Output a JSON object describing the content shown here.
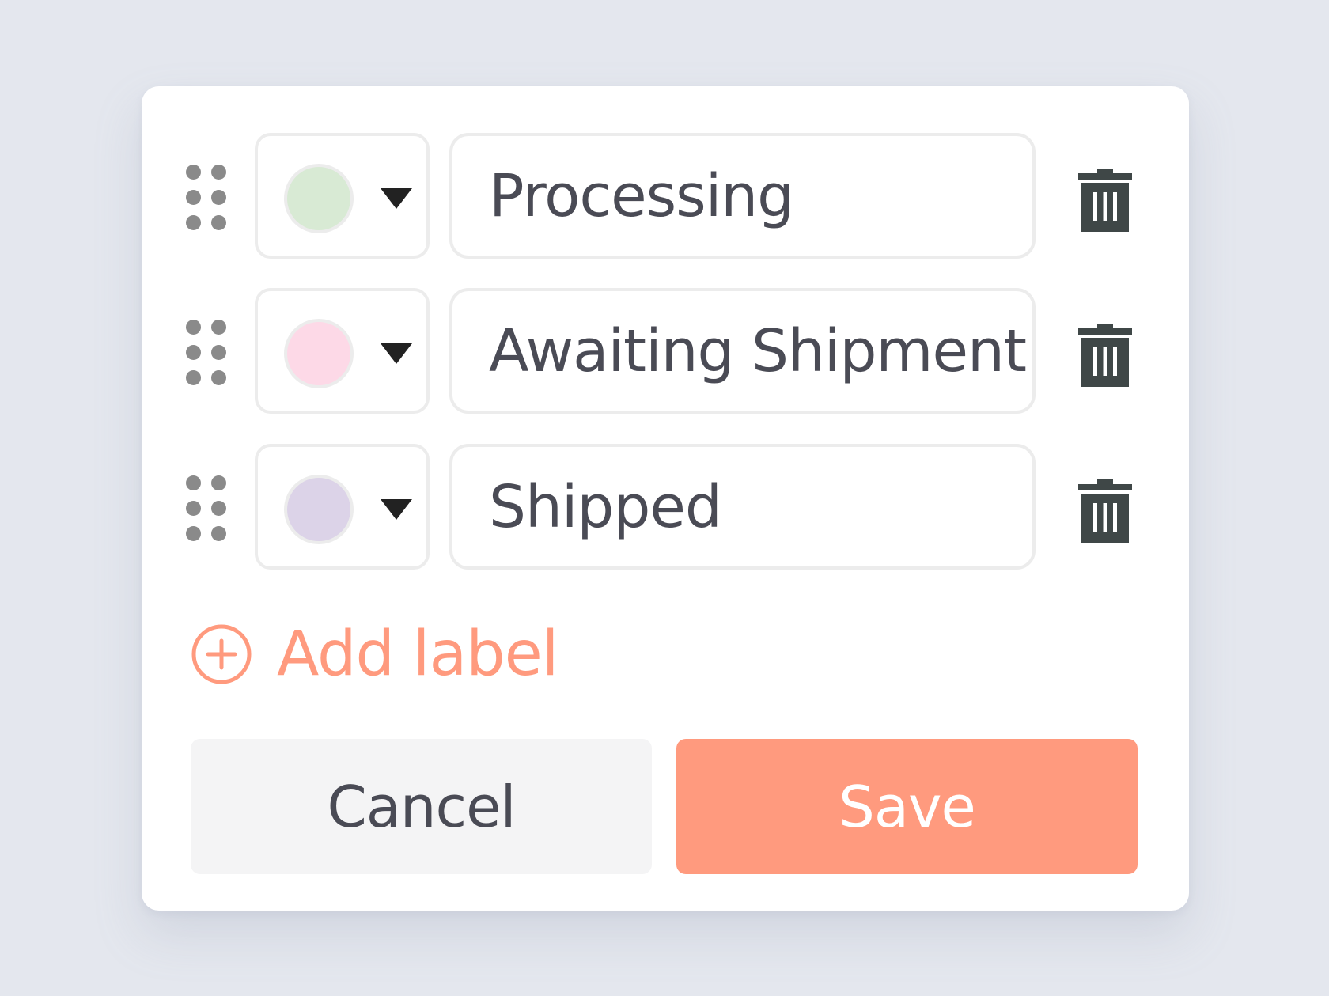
{
  "labels": [
    {
      "name": "Processing",
      "color": "#d8ead4"
    },
    {
      "name": "Awaiting Shipment",
      "color": "#fdd9e7"
    },
    {
      "name": "Shipped",
      "color": "#dcd3e8"
    }
  ],
  "icons": {
    "drag": "drag-handle-icon",
    "caret": "caret-down-icon",
    "delete": "trash-icon",
    "add": "plus-circle-icon"
  },
  "actions": {
    "add_label": "Add label",
    "cancel": "Cancel",
    "save": "Save"
  },
  "colors": {
    "accent": "#ff9a7e",
    "trash": "#3f4747",
    "text": "#4a4b55",
    "drag_dots": "#8a8a8a",
    "cancel_bg": "#f4f4f5",
    "page_bg": "#e4e7ee"
  }
}
